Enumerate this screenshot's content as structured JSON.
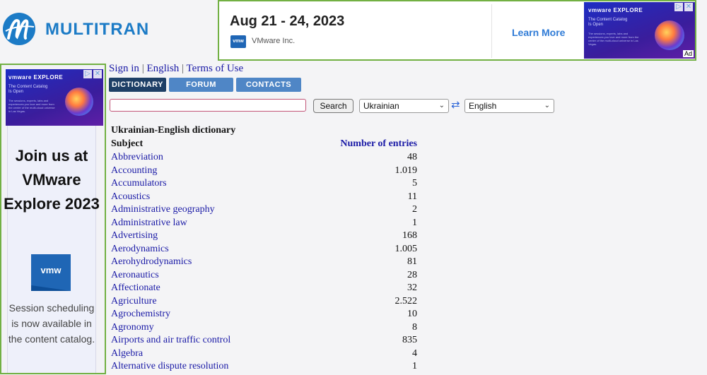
{
  "logo": {
    "text": "MULTITRAN",
    "icon": "multitran-logo-icon"
  },
  "top_ad": {
    "date": "Aug 21 - 24, 2023",
    "company": "VMware Inc.",
    "cta": "Learn More",
    "thumb_brand": "vmware EXPLORE",
    "thumb_heading": "The Content Catalog Is Open",
    "thumb_body": "The sessions, experts, labs and experiences you love and more from the center of the multi-cloud universe in Las Vegas.",
    "ad_label": "Ad"
  },
  "side_ad": {
    "brand": "vmware EXPLORE",
    "banner_heading": "The Content Catalog Is Open",
    "banner_body": "The sessions, experts, labs and experiences you love and more from the center of the multi-cloud universe in Las Vegas.",
    "headline": "Join us at VMware Explore 2023",
    "badge": "vmw",
    "body": "Session scheduling is now available in the content catalog."
  },
  "nav": {
    "sign_in": "Sign in",
    "language": "English",
    "terms": "Terms of Use",
    "tabs": [
      "DICTIONARY",
      "FORUM",
      "CONTACTS"
    ]
  },
  "search": {
    "button": "Search",
    "value": "",
    "from_lang": "Ukrainian",
    "to_lang": "English"
  },
  "dictionary": {
    "title": "Ukrainian-English dictionary",
    "col_subject": "Subject",
    "col_count": "Number of entries",
    "rows": [
      {
        "subject": "Abbreviation",
        "count": "48"
      },
      {
        "subject": "Accounting",
        "count": "1.019"
      },
      {
        "subject": "Accumulators",
        "count": "5"
      },
      {
        "subject": "Acoustics",
        "count": "11"
      },
      {
        "subject": "Administrative geography",
        "count": "2"
      },
      {
        "subject": "Administrative law",
        "count": "1"
      },
      {
        "subject": "Advertising",
        "count": "168"
      },
      {
        "subject": "Aerodynamics",
        "count": "1.005"
      },
      {
        "subject": "Aerohydrodynamics",
        "count": "81"
      },
      {
        "subject": "Aeronautics",
        "count": "28"
      },
      {
        "subject": "Affectionate",
        "count": "32"
      },
      {
        "subject": "Agriculture",
        "count": "2.522"
      },
      {
        "subject": "Agrochemistry",
        "count": "10"
      },
      {
        "subject": "Agronomy",
        "count": "8"
      },
      {
        "subject": "Airports and air traffic control",
        "count": "835"
      },
      {
        "subject": "Algebra",
        "count": "4"
      },
      {
        "subject": "Alternative dispute resolution",
        "count": "1"
      }
    ]
  }
}
